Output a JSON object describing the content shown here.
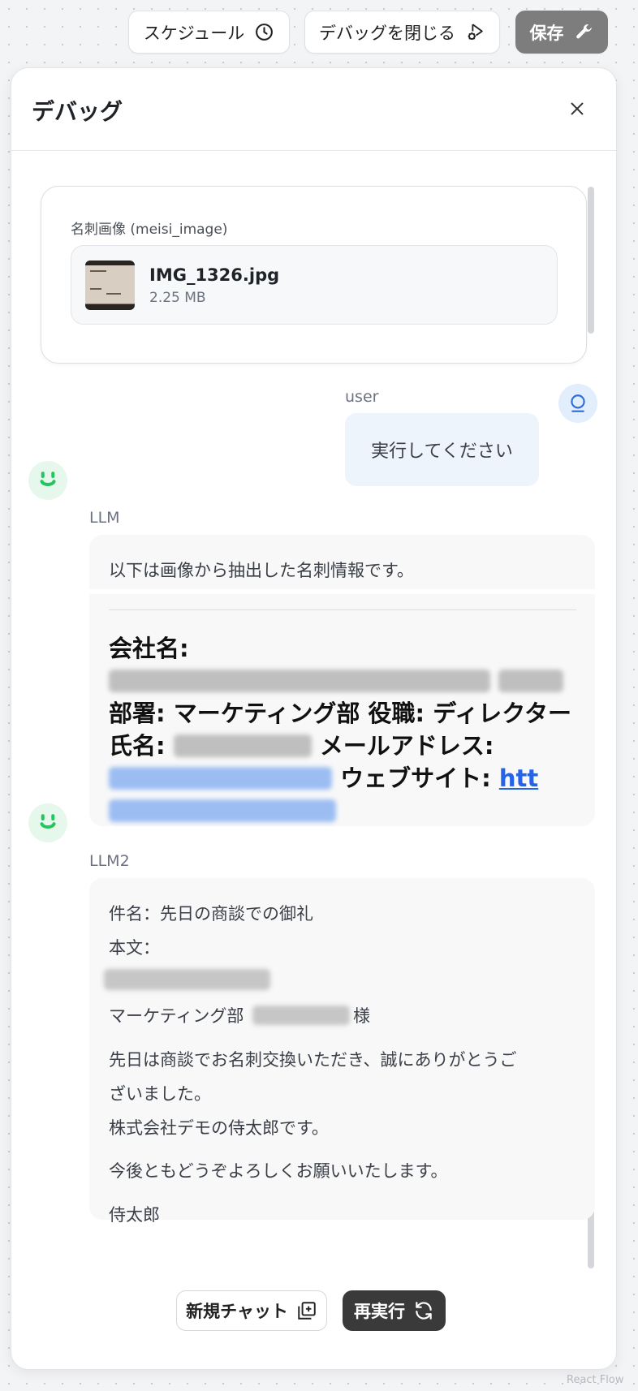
{
  "toolbar": {
    "schedule_label": "スケジュール",
    "close_debug_label": "デバッグを閉じる",
    "save_label": "保存"
  },
  "panel": {
    "title": "デバッグ",
    "input_card": {
      "label": "名刺画像 (meisi_image)",
      "file_name": "IMG_1326.jpg",
      "file_size": "2.25 MB"
    },
    "user_message": {
      "role": "user",
      "text": "実行してください"
    },
    "llm_message": {
      "role": "LLM",
      "intro": "以下は画像から抽出した名刺情報です。",
      "company_label": "会社名:",
      "department_label": "部署:",
      "department_value": "マーケティング部",
      "position_label": "役職:",
      "position_value": "ディレクター",
      "name_label": "氏名:",
      "email_label": "メールアドレス:",
      "website_label": "ウェブサイト:",
      "website_link_visible": "htt"
    },
    "llm2_message": {
      "role": "LLM2",
      "subject_line": "件名：先日の商談での御礼",
      "body_label": "本文：",
      "department_line": "マーケティング部",
      "honorific": "様",
      "para1_line1": "先日は商談でお名刺交換いただき、誠にありがとうご",
      "para1_line2": "ざいました。",
      "para2": "株式会社デモの侍太郎です。",
      "para3": "今後ともどうぞよろしくお願いいたします。",
      "signature": "侍太郎"
    },
    "footer": {
      "new_chat_label": "新規チャット",
      "rerun_label": "再実行"
    }
  },
  "attribution": "React Flow",
  "colors": {
    "save_button": "#7d7d7d",
    "rerun_button": "#3a3a3a",
    "user_bubble": "#eef4fc",
    "bot_avatar": "#4ade80",
    "link": "#2563eb"
  },
  "icons": {
    "schedule": "clock-icon",
    "close_debug": "bug-play-icon",
    "save": "wrench-icon",
    "close": "close-icon",
    "user": "user-avatar-icon",
    "bot": "bot-smile-icon",
    "new_chat": "add-square-icon",
    "rerun": "refresh-icon"
  }
}
